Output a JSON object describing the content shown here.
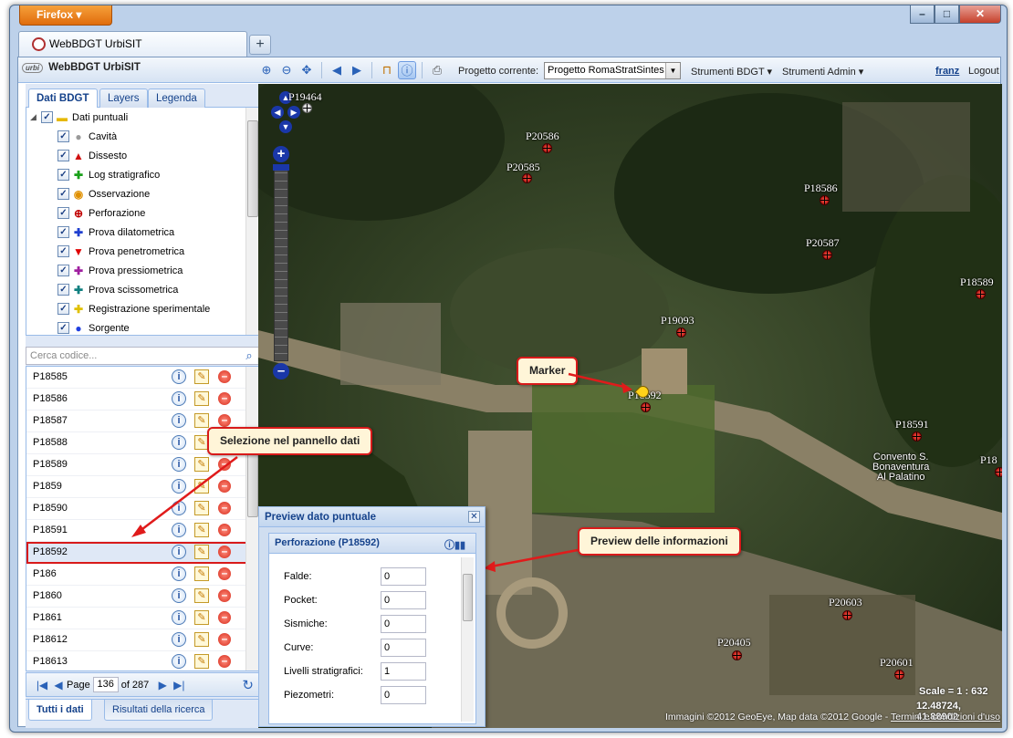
{
  "browser": {
    "app_button": "Firefox",
    "tab_title": "WebBDGT UrbiSIT",
    "new_tab": "+"
  },
  "app": {
    "title": "WebBDGT UrbiSIT",
    "logo_text": "urbi",
    "project_label": "Progetto corrente:",
    "project_value": "Progetto RomaStratSintes",
    "menu_bdgt": "Strumenti BDGT ▾",
    "menu_admin": "Strumenti Admin ▾",
    "user": "franz",
    "logout": "Logout"
  },
  "left_tabs": [
    "Dati BDGT",
    "Layers",
    "Legenda"
  ],
  "tree": {
    "root": "Dati puntuali",
    "items": [
      {
        "label": "Cavità",
        "icon": "grey-circle",
        "color": "#9a9a9a"
      },
      {
        "label": "Dissesto",
        "icon": "red-triangle",
        "color": "#d01010"
      },
      {
        "label": "Log stratigrafico",
        "icon": "green-cross",
        "color": "#1aa01a"
      },
      {
        "label": "Osservazione",
        "icon": "orange-target",
        "color": "#e09000"
      },
      {
        "label": "Perforazione",
        "icon": "red-crosshair",
        "color": "#c00000"
      },
      {
        "label": "Prova dilatometrica",
        "icon": "blue-cross",
        "color": "#2040d0"
      },
      {
        "label": "Prova penetrometrica",
        "icon": "red-down-triangle",
        "color": "#e00000"
      },
      {
        "label": "Prova pressiometrica",
        "icon": "purple-cross",
        "color": "#a020a0"
      },
      {
        "label": "Prova scissometrica",
        "icon": "teal-cross",
        "color": "#108080"
      },
      {
        "label": "Registrazione sperimentale",
        "icon": "yellow-cross",
        "color": "#e0c000"
      },
      {
        "label": "Sorgente",
        "icon": "blue-circle",
        "color": "#2040e0"
      }
    ]
  },
  "search": {
    "placeholder": "Cerca codice..."
  },
  "codes": [
    "P18585",
    "P18586",
    "P18587",
    "P18588",
    "P18589",
    "P1859",
    "P18590",
    "P18591",
    "P18592",
    "P186",
    "P1860",
    "P1861",
    "P18612",
    "P18613"
  ],
  "selected_code": "P18592",
  "pager": {
    "page_label": "Page",
    "page": "136",
    "of_label": "of 287"
  },
  "bottom_tabs": [
    "Tutti i dati",
    "Risultati della ricerca"
  ],
  "map": {
    "points": [
      {
        "label": "P19464"
      },
      {
        "label": "P20586"
      },
      {
        "label": "P20585"
      },
      {
        "label": "P18586"
      },
      {
        "label": "P20587"
      },
      {
        "label": "P18589"
      },
      {
        "label": "P19093"
      },
      {
        "label": "P18592"
      },
      {
        "label": "P18591"
      },
      {
        "label": "P18"
      },
      {
        "label": "P20603"
      },
      {
        "label": "P20405"
      },
      {
        "label": "P20601"
      }
    ],
    "poi": [
      "Convento S.",
      "Bonaventura",
      "Al Palatino"
    ],
    "scale": "Scale = 1 : 632",
    "coords": "12.48724, 41.88902",
    "attribution": "Immagini ©2012 GeoEye, Map data ©2012 Google -",
    "terms": "Termini e condizioni d'uso"
  },
  "callouts": {
    "marker": "Marker",
    "selection": "Selezione nel pannello dati",
    "preview": "Preview delle informazioni"
  },
  "preview": {
    "title": "Preview dato puntuale",
    "subtitle": "Perforazione (P18592)",
    "fields": [
      {
        "label": "Falde:",
        "value": "0"
      },
      {
        "label": "Pocket:",
        "value": "0"
      },
      {
        "label": "Sismiche:",
        "value": "0"
      },
      {
        "label": "Curve:",
        "value": "0"
      },
      {
        "label": "Livelli stratigrafici:",
        "value": "1"
      },
      {
        "label": "Piezometri:",
        "value": "0"
      }
    ]
  }
}
